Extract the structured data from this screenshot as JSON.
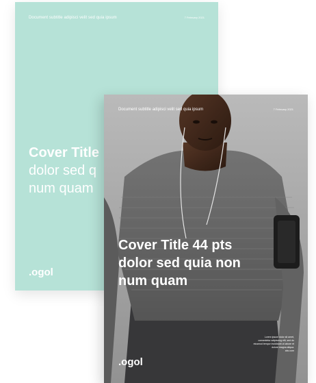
{
  "back_cover": {
    "subtitle": "Document subtitle adipisci velit sed quia ipsum",
    "date": "7 February 2021",
    "title_line1_bold": "Cover Title",
    "title_line2": "dolor sed q",
    "title_line3": "num quam",
    "logo": ".ogol",
    "background_color": "#b6e2d7"
  },
  "front_cover": {
    "subtitle": "Document subtitle adipisci velit sed quia ipsum",
    "date": "7 February 2021",
    "title_line1": "Cover Title 44 pts",
    "title_line2": "dolor sed quia non",
    "title_line3": "num quam",
    "logo": ".ogol",
    "blurb": "Lorem ipsum dolor sit amet, consectetur adipiscing elit, sed do eiusmod tempor incididunt ut labore et dolore magna aliqua.",
    "blurb_ref": "abc.com"
  }
}
